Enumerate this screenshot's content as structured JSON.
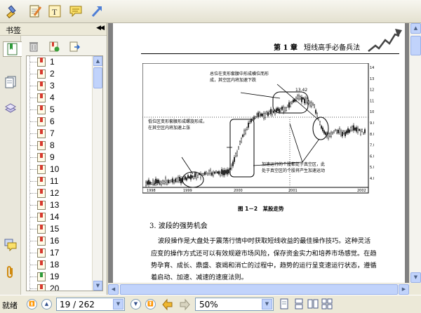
{
  "toolbar": {
    "tools": [
      {
        "name": "highlight-tool",
        "icon": "highlighter-icon"
      },
      {
        "name": "note-edit-tool",
        "icon": "notepad-pencil-icon"
      },
      {
        "name": "text-tool",
        "icon": "text-box-icon"
      },
      {
        "name": "comment-tool",
        "icon": "speech-bubble-icon"
      },
      {
        "name": "arrow-tool",
        "icon": "arrow-icon"
      }
    ]
  },
  "sidebar": {
    "title": "书签",
    "collapse_icon": "double-chevron-left-icon",
    "tabs": [
      {
        "name": "bookmarks-tab",
        "icon": "bookmark-icon",
        "active": true
      },
      {
        "name": "pages-tab",
        "icon": "pages-icon"
      },
      {
        "name": "layers-tab",
        "icon": "layers-icon"
      },
      {
        "name": "comments-tab",
        "icon": "comments-icon"
      },
      {
        "name": "attachments-tab",
        "icon": "paperclip-icon"
      }
    ],
    "bookmark_tools": [
      {
        "name": "delete-bookmark-button",
        "icon": "trash-icon"
      },
      {
        "name": "add-bookmark-button",
        "icon": "add-bookmark-icon"
      },
      {
        "name": "bookmark-options-button",
        "icon": "bookmark-arrow-icon"
      }
    ],
    "bookmarks": [
      "1",
      "2",
      "3",
      "4",
      "5",
      "6",
      "7",
      "8",
      "9",
      "10",
      "11",
      "12",
      "13",
      "14",
      "15",
      "16",
      "17",
      "18",
      "19",
      "20"
    ],
    "current_bookmark": "19"
  },
  "document": {
    "header_chapter": "第 1 章",
    "header_title": "短线高手必备兵法",
    "chart": {
      "annotation_top": [
        "总位在变形套腰中形成横位而形",
        "成，其空区内将加速下跌"
      ],
      "annotation_left": [
        "低位区变形套腰形成螺旋形成，",
        "在其空区内将加速上涨"
      ],
      "annotation_bottom": [
        "加速运行的个股都处于真空区，此",
        "处于真空区的个股将产生加速运动"
      ],
      "price_label": "13.42",
      "low_label": "3.21",
      "y_ticks": [
        "14.00",
        "13.00",
        "12.00",
        "11.00",
        "10.00",
        "9.00",
        "8.00",
        "7.00",
        "6.00",
        "5.00",
        "4.00"
      ],
      "x_ticks": [
        "1998",
        "1999",
        "2000",
        "2001",
        "2002"
      ]
    },
    "caption": "图 1－2　某股走势",
    "section_title": "3. 波段的强势机会",
    "paragraph": [
      "波段操作是大盘处于震荡行情中时获取短线收益的最佳操作技巧。这种灵活",
      "应变的操作方式还可以有效规避市场风险，保存资金实力和培养市场感觉。在趋",
      "势孕育、成长、鼎盛、衰竭和消亡的过程中，趋势的运行呈变速运行状态，遵循",
      "着启动、加速、减速的速度法则。"
    ]
  },
  "statusbar": {
    "status": "就绪",
    "page_display": "19 / 262",
    "zoom": "50%"
  },
  "colors": {
    "accent_red": "#d63a2e",
    "scroll_blue": "#c1d3fb"
  }
}
